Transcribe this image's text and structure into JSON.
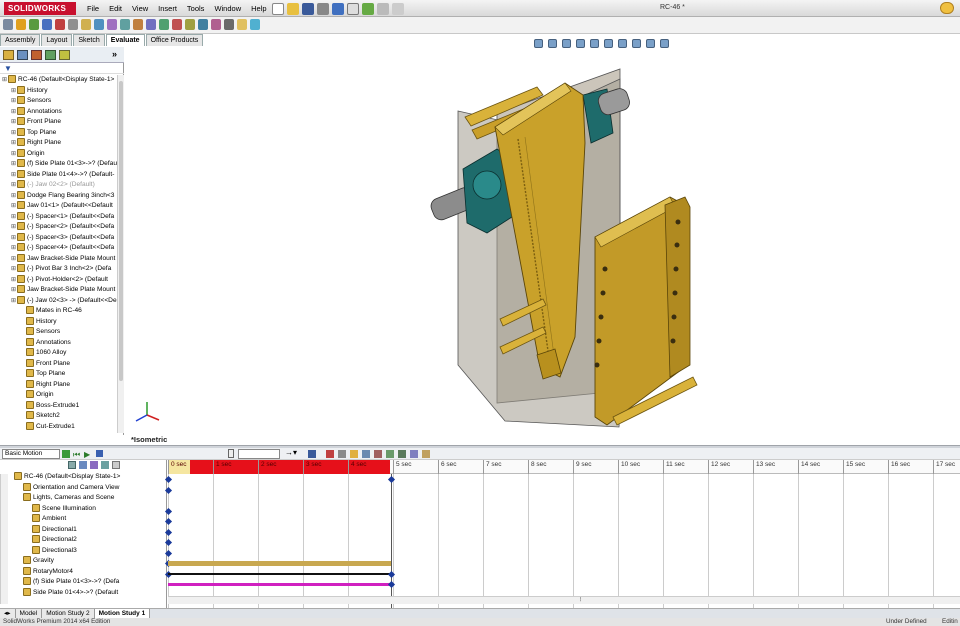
{
  "app": {
    "logo_text": "SOLIDWORKS",
    "doc_title": "RC-46 *"
  },
  "menu": [
    "File",
    "Edit",
    "View",
    "Insert",
    "Tools",
    "Window",
    "Help"
  ],
  "command_tabs": [
    {
      "label": "Assembly",
      "active": false
    },
    {
      "label": "Layout",
      "active": false
    },
    {
      "label": "Sketch",
      "active": false
    },
    {
      "label": "Evaluate",
      "active": true
    },
    {
      "label": "Office Products",
      "active": false
    }
  ],
  "feature_tree": [
    {
      "label": "RC-46  (Default<Display State-1>",
      "indent": 0,
      "dim": false
    },
    {
      "label": "History",
      "indent": 1,
      "dim": false
    },
    {
      "label": "Sensors",
      "indent": 1,
      "dim": false
    },
    {
      "label": "Annotations",
      "indent": 1,
      "dim": false
    },
    {
      "label": "Front Plane",
      "indent": 1,
      "dim": false
    },
    {
      "label": "Top Plane",
      "indent": 1,
      "dim": false
    },
    {
      "label": "Right Plane",
      "indent": 1,
      "dim": false
    },
    {
      "label": "Origin",
      "indent": 1,
      "dim": false
    },
    {
      "label": "(f) Side Plate 01<3>->? (Defau",
      "indent": 1,
      "dim": false
    },
    {
      "label": "Side Plate 01<4>->? (Default-",
      "indent": 1,
      "dim": false
    },
    {
      "label": "(-) Jaw 02<2> (Default)",
      "indent": 1,
      "dim": true
    },
    {
      "label": "Dodge Flang Bearing 3inch<3",
      "indent": 1,
      "dim": false
    },
    {
      "label": "Jaw 01<1> (Default<<Default",
      "indent": 1,
      "dim": false
    },
    {
      "label": "(-) Spacer<1> (Default<<Defa",
      "indent": 1,
      "dim": false
    },
    {
      "label": "(-) Spacer<2> (Default<<Defa",
      "indent": 1,
      "dim": false
    },
    {
      "label": "(-) Spacer<3> (Default<<Defa",
      "indent": 1,
      "dim": false
    },
    {
      "label": "(-) Spacer<4> (Default<<Defa",
      "indent": 1,
      "dim": false
    },
    {
      "label": "Jaw Bracket-Side Plate Mount",
      "indent": 1,
      "dim": false
    },
    {
      "label": "(-) Pivot Bar 3 Inch<2> (Defa",
      "indent": 1,
      "dim": false
    },
    {
      "label": "(-) Pivot-Holder<2> (Default",
      "indent": 1,
      "dim": false
    },
    {
      "label": "Jaw Bracket-Side Plate Mount",
      "indent": 1,
      "dim": false
    },
    {
      "label": "(-) Jaw 02<3> -> (Default<<De",
      "indent": 1,
      "dim": false
    },
    {
      "label": "Mates in RC-46",
      "indent": 2,
      "dim": false
    },
    {
      "label": "History",
      "indent": 2,
      "dim": false
    },
    {
      "label": "Sensors",
      "indent": 2,
      "dim": false
    },
    {
      "label": "Annotations",
      "indent": 2,
      "dim": false
    },
    {
      "label": "1060 Alloy",
      "indent": 2,
      "dim": false
    },
    {
      "label": "Front Plane",
      "indent": 2,
      "dim": false
    },
    {
      "label": "Top Plane",
      "indent": 2,
      "dim": false
    },
    {
      "label": "Right Plane",
      "indent": 2,
      "dim": false
    },
    {
      "label": "Origin",
      "indent": 2,
      "dim": false
    },
    {
      "label": "Boss-Extrude1",
      "indent": 2,
      "dim": false
    },
    {
      "label": "Sketch2",
      "indent": 2,
      "dim": false
    },
    {
      "label": "Cut-Extrude1",
      "indent": 2,
      "dim": false
    }
  ],
  "viewport": {
    "view_label": "*Isometric"
  },
  "motion": {
    "study_type": "Basic Motion",
    "time_ticks": [
      "0 sec",
      "1 sec",
      "2 sec",
      "3 sec",
      "4 sec",
      "5 sec",
      "6 sec",
      "7 sec",
      "8 sec",
      "9 sec",
      "10 sec",
      "11 sec",
      "12 sec",
      "13 sec",
      "14 sec",
      "15 sec",
      "16 sec",
      "17 sec"
    ],
    "tree": [
      {
        "label": "RC-46  (Default<Display State-1>",
        "indent": 0
      },
      {
        "label": "Orientation and Camera View",
        "indent": 1
      },
      {
        "label": "Lights, Cameras and Scene",
        "indent": 1
      },
      {
        "label": "Scene Illumination",
        "indent": 2
      },
      {
        "label": "Ambient",
        "indent": 2
      },
      {
        "label": "Directional1",
        "indent": 2
      },
      {
        "label": "Directional2",
        "indent": 2
      },
      {
        "label": "Directional3",
        "indent": 2
      },
      {
        "label": "Gravity",
        "indent": 1
      },
      {
        "label": "RotaryMotor4",
        "indent": 1
      },
      {
        "label": "(f) Side Plate 01<3>->? (Defa",
        "indent": 1
      },
      {
        "label": "Side Plate 01<4>->? (Default",
        "indent": 1
      }
    ]
  },
  "bottom_tabs": [
    {
      "label": "Model",
      "active": false
    },
    {
      "label": "Motion Study 2",
      "active": false
    },
    {
      "label": "Motion Study 1",
      "active": true
    }
  ],
  "status": {
    "left": "SolidWorks Premium 2014 x64 Edition",
    "right1": "Under Defined",
    "right2": "Editin"
  },
  "colors": {
    "accent_red": "#e6101a",
    "brand": "#c8102e",
    "key_blue": "#1a3a9a",
    "gravity_bar": "#c8a850",
    "motor_bar": "#d020c0"
  }
}
